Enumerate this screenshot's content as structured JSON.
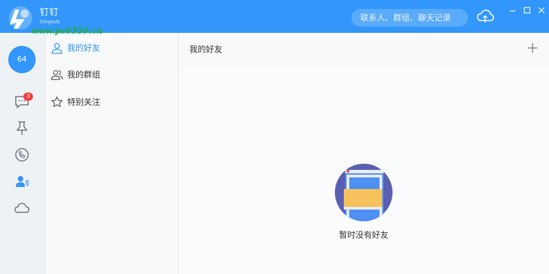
{
  "app": {
    "name": "钉钉",
    "subtitle": "Dingtalk",
    "watermark": "www.pc0359.cn"
  },
  "titlebar": {
    "search_placeholder": "联系人、群组、聊天记录",
    "icons": [
      "cloud-icon",
      "minimize-icon",
      "maximize-icon",
      "close-icon"
    ]
  },
  "sidebar": {
    "avatar_text": "64",
    "message_badge": "3",
    "items": [
      {
        "name": "messages",
        "icon": "chat-bubble-icon"
      },
      {
        "name": "ding",
        "icon": "pin-icon"
      },
      {
        "name": "phone",
        "icon": "phone-icon"
      },
      {
        "name": "contacts",
        "icon": "contacts-icon",
        "active": true
      },
      {
        "name": "cloud",
        "icon": "cloud-icon"
      }
    ]
  },
  "contacts": {
    "items": [
      {
        "label": "我的好友",
        "icon": "person-icon",
        "active": true
      },
      {
        "label": "我的群组",
        "icon": "group-icon",
        "active": false
      },
      {
        "label": "特别关注",
        "icon": "star-icon",
        "active": false
      }
    ]
  },
  "main": {
    "title": "我的好友",
    "add_icon": "plus-icon",
    "empty_text": "暂时没有好友"
  },
  "colors": {
    "accent": "#3296fa",
    "badge": "#f23d3d",
    "illustration_bg": "#5a5fb0"
  }
}
